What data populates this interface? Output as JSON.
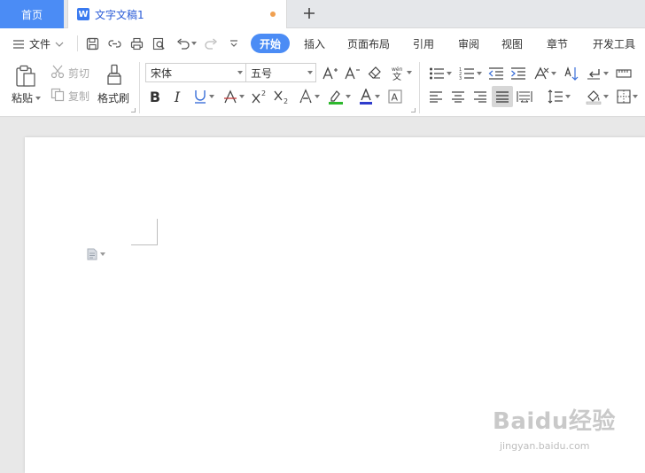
{
  "tabs": {
    "home": "首页",
    "document": "文字文稿1"
  },
  "menu": {
    "file": "文件",
    "tabs": [
      "开始",
      "插入",
      "页面布局",
      "引用",
      "审阅",
      "视图",
      "章节",
      "开发工具"
    ]
  },
  "ribbon": {
    "paste": "粘贴",
    "cut": "剪切",
    "copy": "复制",
    "format_painter": "格式刷",
    "font_name": "宋体",
    "font_size": "五号"
  },
  "watermark": {
    "brand": "Baidu经验",
    "url": "jingyan.baidu.com"
  },
  "colors": {
    "accent": "#4b8cf5",
    "highlight": "#2db82d",
    "font_color": "#2f3ccc",
    "modified_dot": "#f0a050"
  }
}
